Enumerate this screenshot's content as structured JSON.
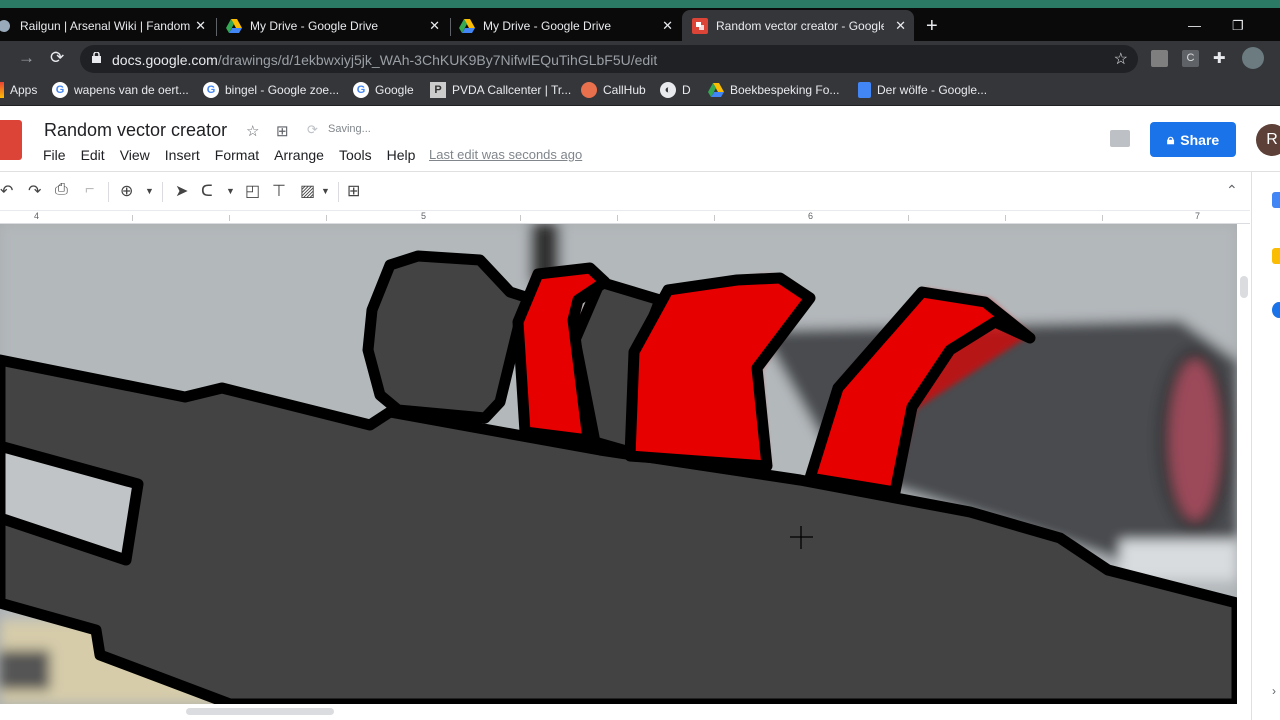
{
  "browser": {
    "tabs": [
      {
        "title": "Railgun | Arsenal Wiki | Fandom",
        "icon": "fandom-icon",
        "active": false
      },
      {
        "title": "My Drive - Google Drive",
        "icon": "google-drive-icon",
        "active": false
      },
      {
        "title": "My Drive - Google Drive",
        "icon": "google-drive-icon",
        "active": false
      },
      {
        "title": "Random vector creator - Google",
        "icon": "google-drawings-icon",
        "active": true
      }
    ],
    "new_tab": "+",
    "close_glyph": "✕",
    "window_controls": {
      "minimize": "—",
      "restore": "❐"
    },
    "url_host": "docs.google.com",
    "url_path": "/drawings/d/1ekbwxiyj5jk_WAh-3ChKUK9By7NifwlEQuTihGLbF5U/edit",
    "bookmarks": [
      {
        "label": "Apps",
        "icon": "apps-grid-icon"
      },
      {
        "label": "wapens van de oert...",
        "icon": "google-icon"
      },
      {
        "label": "bingel - Google zoe...",
        "icon": "google-icon"
      },
      {
        "label": "Google",
        "icon": "google-icon"
      },
      {
        "label": "PVDA Callcenter | Tr...",
        "icon": "pvda-icon"
      },
      {
        "label": "CallHub",
        "icon": "callhub-icon"
      },
      {
        "label": "D",
        "icon": "globe-icon"
      },
      {
        "label": "Boekbespeking Fo...",
        "icon": "google-drive-icon"
      },
      {
        "label": "Der wölfe - Google...",
        "icon": "google-docs-icon"
      }
    ]
  },
  "app": {
    "title": "Random vector creator",
    "status": "Saving...",
    "menu": [
      "File",
      "Edit",
      "View",
      "Insert",
      "Format",
      "Arrange",
      "Tools",
      "Help"
    ],
    "last_edit": "Last edit was seconds ago",
    "share_label": "Share",
    "avatar_initial": "R"
  },
  "toolbar": {
    "tools": [
      "undo",
      "redo",
      "print",
      "paint-format",
      "zoom",
      "select",
      "line",
      "shape",
      "text-box",
      "image",
      "add-comment"
    ]
  },
  "ruler": {
    "labels": [
      "4",
      "5",
      "6",
      "7"
    ]
  },
  "colors": {
    "accent": "#1a73e8",
    "shape_fill_gray": "#434343",
    "shape_fill_red": "#e60000",
    "stroke": "#000000"
  }
}
